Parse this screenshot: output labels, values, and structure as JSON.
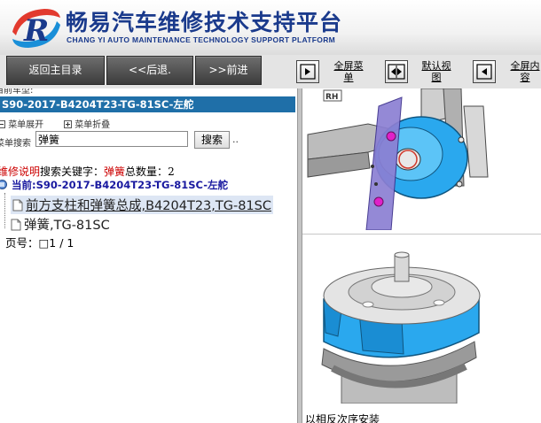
{
  "header": {
    "title": "畅易汽车维修技术支持平台",
    "subtitle": "CHANG YI AUTO MAINTENANCE TECHNOLOGY SUPPORT PLATFORM",
    "logo_letter": "R"
  },
  "toolbar": {
    "home_label": "返回主目录",
    "back_label": "<<后退.",
    "forward_label": ">>前进",
    "fullscreen_menu_label": "全屏菜单",
    "default_view_label": "默认视图",
    "fullscreen_content_label": "全屏内容"
  },
  "left": {
    "vehicle_label": "当前车型:",
    "model": "S90-2017-B4204T23-TG-81SC-左舵",
    "expand_label": "菜单展开",
    "collapse_label": "菜单折叠",
    "search_label": "菜单搜索",
    "search_value": "弹簧",
    "search_button": "搜索",
    "search_dots": "..",
    "summary_prefix": "维修说明",
    "summary_keyword_label": "搜索关键字：",
    "summary_keyword": "弹簧",
    "summary_count_label": "总数量：",
    "summary_count": "2",
    "current_prefix": "当前:",
    "current_path": "S90-2017-B4204T23-TG-81SC-左舵",
    "results": [
      "前方支柱和弹簧总成,B4204T23,TG-81SC",
      "弹簧,TG-81SC"
    ],
    "pager": "页号：□1 / 1"
  },
  "right": {
    "rh_tag": "RH",
    "instruction": "以相反次序安装"
  },
  "colors": {
    "brand_blue": "#1a3a8c",
    "model_bar": "#1f6fa8",
    "part_blue": "#2aa8ee",
    "highlight_red": "#cc0000"
  }
}
